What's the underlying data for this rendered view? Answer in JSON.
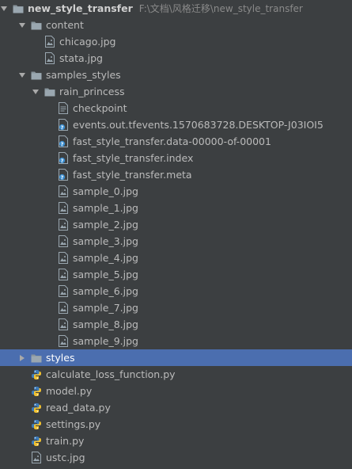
{
  "project": {
    "name": "new_style_transfer",
    "path": "F:\\文档\\风格迁移\\new_style_transfer"
  },
  "tree": [
    {
      "label": "content",
      "kind": "folder",
      "expanded": true,
      "depth": 1,
      "icon": "folder-icon"
    },
    {
      "label": "chicago.jpg",
      "kind": "image",
      "depth": 2,
      "icon": "image-file-icon"
    },
    {
      "label": "stata.jpg",
      "kind": "image",
      "depth": 2,
      "icon": "image-file-icon"
    },
    {
      "label": "samples_styles",
      "kind": "folder",
      "expanded": true,
      "depth": 1,
      "icon": "folder-icon"
    },
    {
      "label": "rain_princess",
      "kind": "folder",
      "expanded": true,
      "depth": 2,
      "icon": "folder-icon"
    },
    {
      "label": "checkpoint",
      "kind": "text",
      "depth": 3,
      "icon": "text-file-icon"
    },
    {
      "label": "events.out.tfevents.1570683728.DESKTOP-J03IOI5",
      "kind": "unknown",
      "depth": 3,
      "icon": "unknown-file-icon"
    },
    {
      "label": "fast_style_transfer.data-00000-of-00001",
      "kind": "unknown",
      "depth": 3,
      "icon": "unknown-file-icon"
    },
    {
      "label": "fast_style_transfer.index",
      "kind": "unknown",
      "depth": 3,
      "icon": "unknown-file-icon"
    },
    {
      "label": "fast_style_transfer.meta",
      "kind": "unknown",
      "depth": 3,
      "icon": "unknown-file-icon"
    },
    {
      "label": "sample_0.jpg",
      "kind": "image",
      "depth": 3,
      "icon": "image-file-icon"
    },
    {
      "label": "sample_1.jpg",
      "kind": "image",
      "depth": 3,
      "icon": "image-file-icon"
    },
    {
      "label": "sample_2.jpg",
      "kind": "image",
      "depth": 3,
      "icon": "image-file-icon"
    },
    {
      "label": "sample_3.jpg",
      "kind": "image",
      "depth": 3,
      "icon": "image-file-icon"
    },
    {
      "label": "sample_4.jpg",
      "kind": "image",
      "depth": 3,
      "icon": "image-file-icon"
    },
    {
      "label": "sample_5.jpg",
      "kind": "image",
      "depth": 3,
      "icon": "image-file-icon"
    },
    {
      "label": "sample_6.jpg",
      "kind": "image",
      "depth": 3,
      "icon": "image-file-icon"
    },
    {
      "label": "sample_7.jpg",
      "kind": "image",
      "depth": 3,
      "icon": "image-file-icon"
    },
    {
      "label": "sample_8.jpg",
      "kind": "image",
      "depth": 3,
      "icon": "image-file-icon"
    },
    {
      "label": "sample_9.jpg",
      "kind": "image",
      "depth": 3,
      "icon": "image-file-icon"
    },
    {
      "label": "styles",
      "kind": "folder",
      "expanded": false,
      "selected": true,
      "depth": 1,
      "icon": "folder-icon"
    },
    {
      "label": "calculate_loss_function.py",
      "kind": "python",
      "depth": 1,
      "icon": "python-file-icon"
    },
    {
      "label": "model.py",
      "kind": "python",
      "depth": 1,
      "icon": "python-file-icon"
    },
    {
      "label": "read_data.py",
      "kind": "python",
      "depth": 1,
      "icon": "python-file-icon"
    },
    {
      "label": "settings.py",
      "kind": "python",
      "depth": 1,
      "icon": "python-file-icon"
    },
    {
      "label": "train.py",
      "kind": "python",
      "depth": 1,
      "icon": "python-file-icon"
    },
    {
      "label": "ustc.jpg",
      "kind": "image",
      "depth": 1,
      "icon": "image-file-icon"
    }
  ],
  "colors": {
    "background": "#3c3f41",
    "selection": "#4b6eaf",
    "text": "#bbbbbb",
    "path_text": "#8a8a8a"
  }
}
